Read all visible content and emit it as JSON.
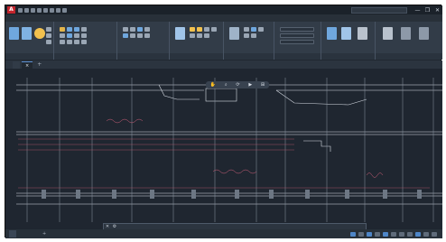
{
  "app": {
    "logo": "A",
    "title": "",
    "search_placeholder": "",
    "user": "",
    "accent": "#c4262e"
  },
  "window_controls": [
    "—",
    "❐",
    "✕"
  ],
  "menu": {
    "tabs": [
      {
        "label": "",
        "active": true
      },
      {
        "label": "",
        "active": false
      },
      {
        "label": "",
        "active": false
      },
      {
        "label": "",
        "active": false
      },
      {
        "label": "",
        "active": false
      },
      {
        "label": "",
        "active": false
      },
      {
        "label": "",
        "active": false
      },
      {
        "label": "",
        "active": false
      },
      {
        "label": "",
        "active": false
      },
      {
        "label": "",
        "active": false
      },
      {
        "label": "",
        "active": false
      },
      {
        "label": "",
        "active": false
      }
    ]
  },
  "ribbon": {
    "panels": [
      {
        "label": ""
      },
      {
        "label": ""
      },
      {
        "label": ""
      },
      {
        "label": ""
      },
      {
        "label": ""
      },
      {
        "label": ""
      },
      {
        "label": ""
      },
      {
        "label": ""
      }
    ],
    "big_buttons": [
      {
        "label": "",
        "icon": "line-icon",
        "color": "#6fa7de"
      },
      {
        "label": "",
        "icon": "polyline-icon",
        "color": "#7fb2e3"
      },
      {
        "label": "",
        "icon": "circle-icon",
        "color": "#f2c14e"
      },
      {
        "label": "",
        "icon": "text-icon",
        "color": "#9aa6b4"
      },
      {
        "label": "",
        "icon": "layer-properties-icon",
        "color": "#a0c4e8"
      },
      {
        "label": "",
        "icon": "insert-block-icon",
        "color": "#9fb3c8"
      },
      {
        "label": "",
        "icon": "paste-icon",
        "color": "#b9c2cd"
      },
      {
        "label": "",
        "icon": "view-base-icon",
        "color": "#b9c2cd"
      }
    ]
  },
  "document_tabs": {
    "start_label": "",
    "active_label": "",
    "close": "×",
    "add": "+"
  },
  "canvas": {
    "viewport_label": "",
    "nav_toolbar_icons": [
      "pan-icon",
      "zoom-icon",
      "orbit-icon",
      "showmotion-icon",
      "view-icon"
    ],
    "nav_toolbar_glyphs": [
      "✋",
      "⌕",
      "⟳",
      "▶",
      "⊞"
    ],
    "background": "#1f2630",
    "line_color": "#d9dee6",
    "dim_color": "#8b96a3",
    "annotation_color": "#d0607a",
    "annotations": [
      {
        "text": ""
      },
      {
        "text": ""
      }
    ]
  },
  "command_line": {
    "placeholder": "",
    "close_glyph": "✕",
    "wrench_glyph": "⚙"
  },
  "layout_tabs": [
    {
      "label": "",
      "active": true
    },
    {
      "label": "",
      "active": false
    },
    {
      "label": "",
      "active": false
    },
    {
      "label": "+",
      "active": false
    }
  ],
  "status_bar": {
    "text": "",
    "icons": [
      "grid-icon",
      "snap-icon",
      "ortho-icon",
      "polar-icon",
      "osnap-icon",
      "otrack-icon",
      "lineweight-icon",
      "transparency-icon",
      "annotation-scale-icon",
      "workspace-icon",
      "customize-icon"
    ]
  }
}
